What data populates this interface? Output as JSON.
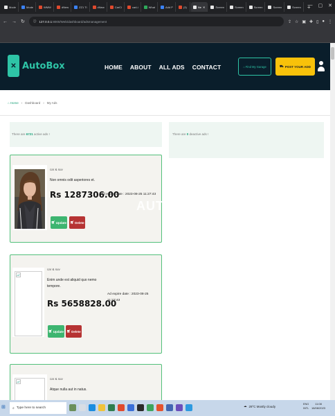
{
  "browser": {
    "tabs": [
      {
        "label": "Mode",
        "fav": "white"
      },
      {
        "label": "Mode",
        "fav": "blue"
      },
      {
        "label": "WMW",
        "fav": "red"
      },
      {
        "label": "dNew",
        "fav": "red"
      },
      {
        "label": "ZZ1 Ti",
        "fav": "blue"
      },
      {
        "label": "dNew",
        "fav": "red"
      },
      {
        "label": "CarCi",
        "fav": "red"
      },
      {
        "label": "carLi",
        "fav": "red"
      },
      {
        "label": "What",
        "fav": "green"
      },
      {
        "label": "Add P",
        "fav": "blue"
      },
      {
        "label": "(3)",
        "fav": "red"
      },
      {
        "label": "Ne",
        "fav": "white",
        "active": true
      },
      {
        "label": "Screen",
        "fav": "white"
      },
      {
        "label": "Screen",
        "fav": "white"
      },
      {
        "label": "Screen",
        "fav": "white"
      },
      {
        "label": "Screen",
        "fav": "white"
      },
      {
        "label": "Screen",
        "fav": "white"
      }
    ],
    "new_tab": "+",
    "url_host": "127.0.0.1",
    "url_path": ":8000/Web/dashboard/adsmanagement"
  },
  "header": {
    "logo_mark": "✕",
    "logo_text": "AutoBox",
    "nav": [
      "HOME",
      "ABOUT",
      "ALL ADS",
      "CONTACT"
    ],
    "garage_button": "Find My Garage",
    "post_button": "POST YOUR ADD"
  },
  "breadcrumb": {
    "home": "Home",
    "dashboard": "Dashboard",
    "current": "My Ads",
    "sep": "›"
  },
  "panels": {
    "active_prefix": "There are ",
    "active_count": "6721",
    "active_suffix": " active ads !",
    "deactive_prefix": "There are ",
    "deactive_count": "0",
    "deactive_suffix": " deactive ads !"
  },
  "watermark": "AUT",
  "ads": [
    {
      "category": "car & suv",
      "description": "Non omnis odit asperiores et.",
      "price": "Rs 1287306.00",
      "expire": "Ad expire date : 2023-08-25 11:27:43",
      "update": "Update",
      "delete": "Delete"
    },
    {
      "category": "car & suv",
      "description": "Enim unde est aliquid quo nemo tempore.",
      "price": "Rs 5658828.00",
      "expire": "Ad expire date : 2023-08-25 11:27:43",
      "update": "Update",
      "delete": "Delete"
    },
    {
      "category": "car & suv",
      "description": "Atque nulla aut in natus."
    }
  ],
  "taskbar": {
    "search_placeholder": "Type here to search",
    "weather": "29°C  Mostly cloudy",
    "lang_top": "ENG",
    "lang_bottom": "INTL",
    "time": "11:08",
    "date": "18/08/2023"
  }
}
